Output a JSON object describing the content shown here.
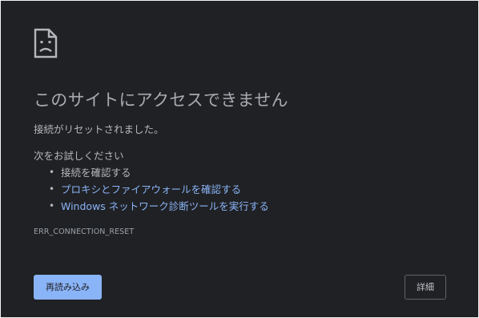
{
  "error_page": {
    "icon": "sad-document-icon",
    "title": "このサイトにアクセスできません",
    "subtitle": "接続がリセットされました。",
    "suggestions_heading": "次をお試しください",
    "suggestions": [
      {
        "label": "接続を確認する",
        "is_link": false
      },
      {
        "label": "プロキシとファイアウォールを確認する",
        "is_link": true
      },
      {
        "label": "Windows ネットワーク診断ツールを実行する",
        "is_link": true
      }
    ],
    "error_code": "ERR_CONNECTION_RESET"
  },
  "buttons": {
    "reload_label": "再読み込み",
    "details_label": "詳細"
  },
  "colors": {
    "background": "#202124",
    "link": "#8ab4f8",
    "primary_button": "#8ab4f8",
    "text": "#b4b7bb"
  }
}
